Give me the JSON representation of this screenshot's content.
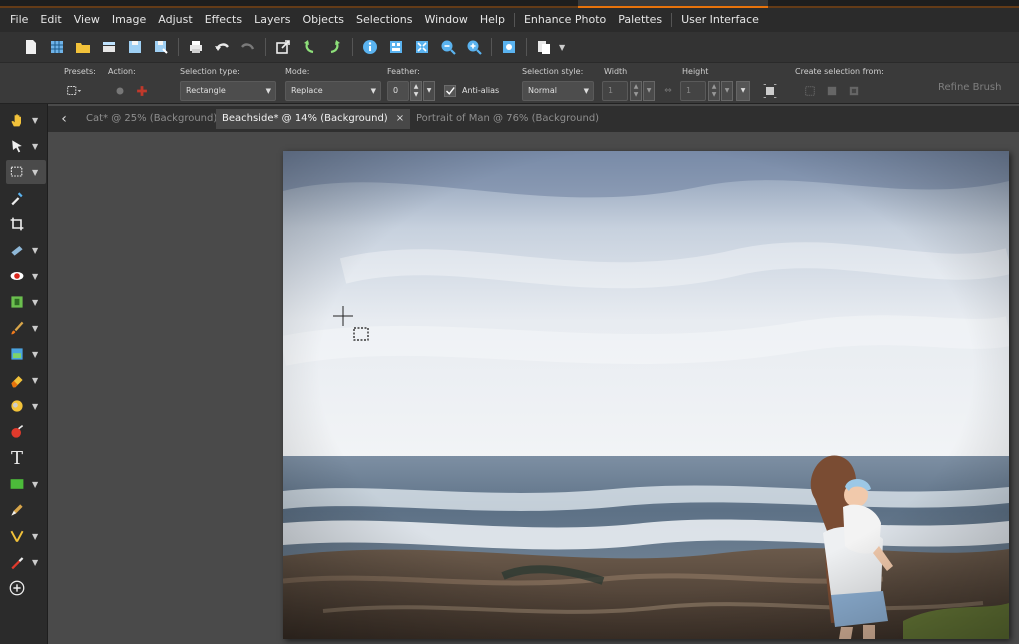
{
  "menu": {
    "items": [
      {
        "label": "File"
      },
      {
        "label": "Edit"
      },
      {
        "label": "View"
      },
      {
        "label": "Image"
      },
      {
        "label": "Adjust"
      },
      {
        "label": "Effects"
      },
      {
        "label": "Layers"
      },
      {
        "label": "Objects"
      },
      {
        "label": "Selections"
      },
      {
        "label": "Window"
      },
      {
        "label": "Help"
      }
    ],
    "extra": [
      {
        "label": "Enhance Photo"
      },
      {
        "label": "Palettes"
      },
      {
        "label": "User Interface"
      }
    ]
  },
  "options": {
    "presets_label": "Presets:",
    "action_label": "Action:",
    "selection_type_label": "Selection type:",
    "selection_type_value": "Rectangle",
    "mode_label": "Mode:",
    "mode_value": "Replace",
    "feather_label": "Feather:",
    "feather_value": "0",
    "antialias_label": "Anti-alias",
    "antialias_checked": true,
    "selection_style_label": "Selection style:",
    "selection_style_value": "Normal",
    "width_label": "Width",
    "width_value": "1",
    "height_label": "Height",
    "height_value": "1",
    "create_selection_label": "Create selection from:",
    "refine_brush_label": "Refine Brush"
  },
  "tabs": [
    {
      "label": "Cat* @  25% (Background)",
      "active": false
    },
    {
      "label": "Beachside* @  14% (Background)",
      "active": true
    },
    {
      "label": "Portrait of Man @  76% (Background)",
      "active": false
    }
  ],
  "tab_close_glyph": "×",
  "tab_back_glyph": "‹",
  "tools": [
    "pan-tool-icon",
    "pick-tool-icon",
    "selection-tool-icon",
    "dropper-tool-icon",
    "crop-tool-icon",
    "straighten-tool-icon",
    "red-eye-tool-icon",
    "makeover-tool-icon",
    "paint-brush-tool-icon",
    "clone-tool-icon",
    "eraser-tool-icon",
    "dodge-tool-icon",
    "color-replacer-tool-icon",
    "text-tool-icon",
    "rectangle-tool-icon",
    "pen-tool-icon",
    "warp-brush-tool-icon",
    "picture-tube-tool-icon",
    "add-tool-icon"
  ],
  "text_tool_glyph": "T",
  "colors": {
    "accent": "#e8730c",
    "menu_bg": "#2b2b2b",
    "workspace_bg": "#4a4a4a"
  }
}
